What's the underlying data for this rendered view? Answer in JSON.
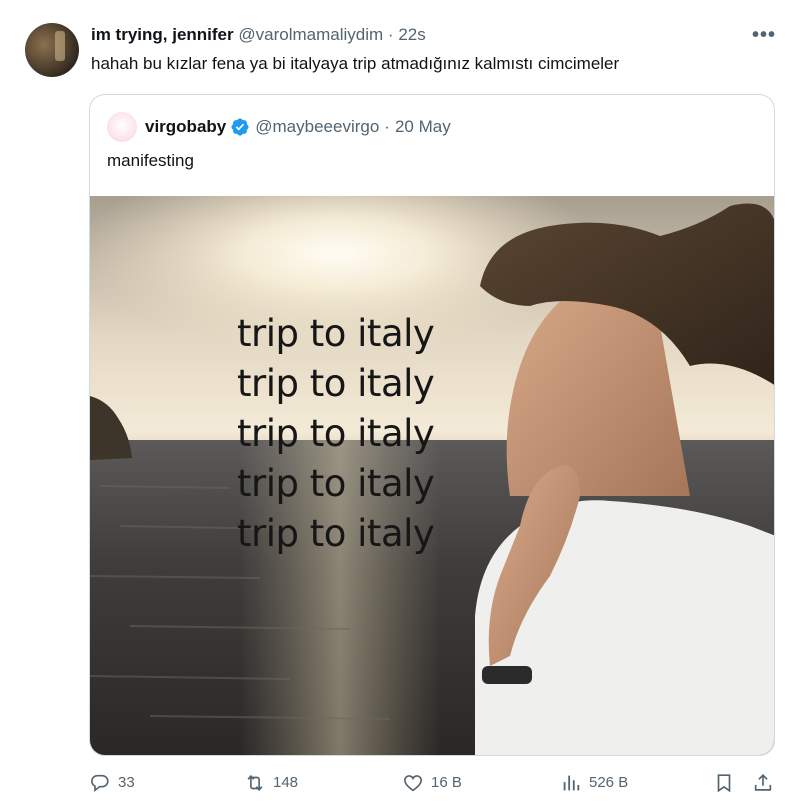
{
  "tweet": {
    "display_name": "im trying, jennifer",
    "handle": "@varolmamaliydim",
    "separator": "·",
    "time": "22s",
    "text": "hahah bu kızlar fena ya bi italyaya trip atmadığınız kalmıstı cimcimeler",
    "more_icon": "more-icon"
  },
  "quoted": {
    "display_name": "virgobaby",
    "verified_icon": "verified-badge-icon",
    "handle": "@maybeeevirgo",
    "separator": "·",
    "date": "20 May",
    "text": "manifesting",
    "image_lines": [
      "trip to italy",
      "trip to italy",
      "trip to italy",
      "trip to italy",
      "trip to italy"
    ]
  },
  "actions": {
    "replies": "33",
    "reposts": "148",
    "likes": "16 B",
    "views": "526 B"
  },
  "colors": {
    "text": "#0f1419",
    "muted": "#536471",
    "border": "#cfd9de",
    "verified": "#1d9bf0"
  }
}
